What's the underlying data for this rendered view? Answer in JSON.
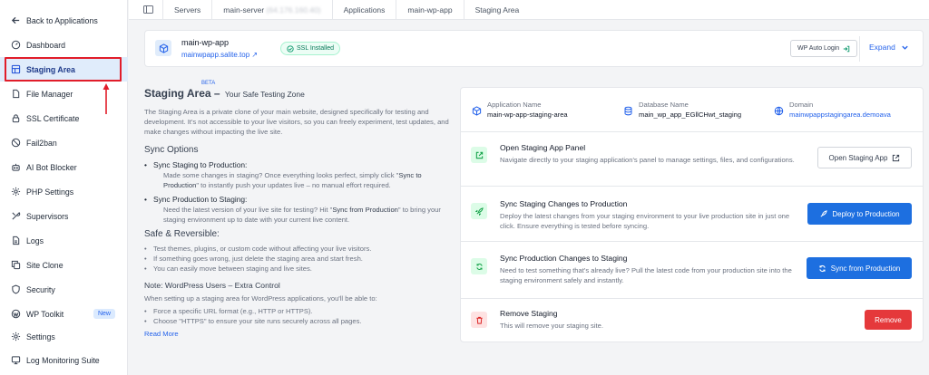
{
  "sidebar": {
    "back": "Back to Applications",
    "items": [
      {
        "label": "Dashboard",
        "icon": "dashboard-icon"
      },
      {
        "label": "Staging Area",
        "icon": "staging-icon",
        "active": true
      },
      {
        "label": "File Manager",
        "icon": "file-icon"
      },
      {
        "label": "SSL Certificate",
        "icon": "lock-icon"
      },
      {
        "label": "Fail2ban",
        "icon": "ban-icon"
      },
      {
        "label": "AI Bot Blocker",
        "icon": "bot-icon"
      },
      {
        "label": "PHP Settings",
        "icon": "gear-icon"
      },
      {
        "label": "Supervisors",
        "icon": "tools-icon"
      },
      {
        "label": "Logs",
        "icon": "logs-icon"
      },
      {
        "label": "Site Clone",
        "icon": "clone-icon"
      },
      {
        "label": "Security",
        "icon": "shield-icon"
      },
      {
        "label": "WP Toolkit",
        "icon": "wordpress-icon",
        "badge": "New"
      },
      {
        "label": "Settings",
        "icon": "gear-icon"
      },
      {
        "label": "Log Monitoring Suite",
        "icon": "monitor-icon"
      }
    ]
  },
  "breadcrumb": {
    "servers": "Servers",
    "server": "main-server",
    "server_ip": "(64.176.160.40)",
    "applications": "Applications",
    "app": "main-wp-app",
    "page": "Staging Area"
  },
  "app": {
    "name": "main-wp-app",
    "url": "mainwpapp.salite.top ↗",
    "ssl": "SSL Installed",
    "wp_auto_login": "WP Auto Login",
    "expand": "Expand"
  },
  "content": {
    "title": "Staging Area –",
    "beta": "BETA",
    "subtitle": "Your Safe Testing Zone",
    "description": "The Staging Area is a private clone of your main website, designed specifically for testing and development. It's not accessible to your live visitors, so you can freely experiment, test updates, and make changes without impacting the live site.",
    "sync_heading": "Sync Options",
    "sync1_title": "Sync Staging to Production:",
    "sync1_desc_a": "Made some changes in staging? Once everything looks perfect, simply click \"",
    "sync1_desc_b": "Sync to Production",
    "sync1_desc_c": "\" to instantly push your updates live – no manual effort required.",
    "sync2_title": "Sync Production to Staging:",
    "sync2_desc_a": "Need the latest version of your live site for testing? Hit \"",
    "sync2_desc_b": "Sync from Production",
    "sync2_desc_c": "\" to bring your staging environment up to date with your current live content.",
    "safe_heading": "Safe & Reversible:",
    "safe_items": [
      "Test themes, plugins, or custom code without affecting your live visitors.",
      "If something goes wrong, just delete the staging area and start fresh.",
      "You can easily move between staging and live sites."
    ],
    "note_heading": "Note: WordPress Users – Extra Control",
    "note_para": "When setting up a staging area for WordPress applications, you'll be able to:",
    "note_items": [
      "Force a specific URL format (e.g., HTTP or HTTPS).",
      "Choose \"HTTPS\" to ensure your site runs securely across all pages."
    ],
    "read_more": "Read More"
  },
  "panel": {
    "app_name_label": "Application Name",
    "app_name_value": "main-wp-app-staging-area",
    "db_label": "Database Name",
    "db_value": "main_wp_app_EGllCHwt_staging",
    "domain_label": "Domain",
    "domain_value": "mainwpappstagingarea.demoava",
    "actions": [
      {
        "title": "Open Staging App Panel",
        "desc": "Navigate directly to your staging application's panel to manage settings, files, and configurations.",
        "button": "Open Staging App"
      },
      {
        "title": "Sync Staging Changes to Production",
        "desc": "Deploy the latest changes from your staging environment to your live production site in just one click. Ensure everything is tested before syncing.",
        "button": "Deploy to Production"
      },
      {
        "title": "Sync Production Changes to Staging",
        "desc": "Need to test something that's already live? Pull the latest code from your production site into the staging environment safely and instantly.",
        "button": "Sync from Production"
      },
      {
        "title": "Remove Staging",
        "desc": "This will remove your staging site.",
        "button": "Remove"
      }
    ]
  },
  "colors": {
    "accent": "#1d6fe0",
    "danger": "#e5393b",
    "highlight": "#e11d2a"
  }
}
